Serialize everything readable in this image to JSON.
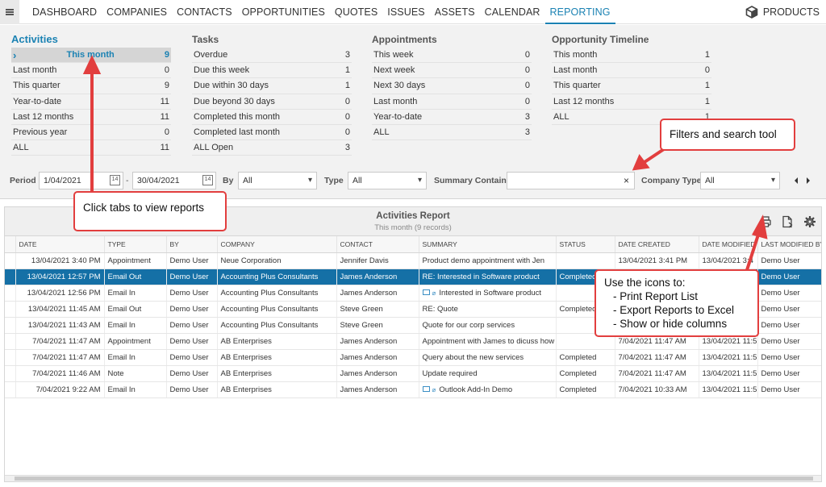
{
  "nav": {
    "items": [
      "DASHBOARD",
      "COMPANIES",
      "CONTACTS",
      "OPPORTUNITIES",
      "QUOTES",
      "ISSUES",
      "ASSETS",
      "CALENDAR",
      "REPORTING"
    ],
    "active": "REPORTING",
    "products": "PRODUCTS"
  },
  "panel": {
    "activities": {
      "title": "Activities",
      "rows": [
        [
          "This month",
          "9"
        ],
        [
          "Last month",
          "0"
        ],
        [
          "This quarter",
          "9"
        ],
        [
          "Year-to-date",
          "11"
        ],
        [
          "Last 12 months",
          "11"
        ],
        [
          "Previous year",
          "0"
        ],
        [
          "ALL",
          "11"
        ]
      ]
    },
    "tasks": {
      "title": "Tasks",
      "rows": [
        [
          "Overdue",
          "3"
        ],
        [
          "Due this week",
          "1"
        ],
        [
          "Due within 30 days",
          "1"
        ],
        [
          "Due beyond 30 days",
          "0"
        ],
        [
          "Completed this month",
          "0"
        ],
        [
          "Completed last month",
          "0"
        ],
        [
          "ALL Open",
          "3"
        ]
      ]
    },
    "appointments": {
      "title": "Appointments",
      "rows": [
        [
          "This week",
          "0"
        ],
        [
          "Next week",
          "0"
        ],
        [
          "Next 30 days",
          "0"
        ],
        [
          "Last month",
          "0"
        ],
        [
          "Year-to-date",
          "3"
        ],
        [
          "ALL",
          "3"
        ]
      ]
    },
    "timeline": {
      "title": "Opportunity Timeline",
      "rows": [
        [
          "This month",
          "1"
        ],
        [
          "Last month",
          "0"
        ],
        [
          "This quarter",
          "1"
        ],
        [
          "Last 12 months",
          "1"
        ],
        [
          "ALL",
          "1"
        ]
      ]
    }
  },
  "filters": {
    "period_label": "Period",
    "period_from": "1/04/2021",
    "dash": "-",
    "period_to": "30/04/2021",
    "by_label": "By",
    "by_value": "All",
    "type_label": "Type",
    "type_value": "All",
    "summary_label": "Summary Contains",
    "summary_value": "",
    "clear": "×",
    "company_type_label": "Company Type",
    "company_type_value": "All",
    "cal_glyph": "14"
  },
  "report": {
    "title": "Activities Report",
    "subtitle": "This month (9 records)",
    "columns": [
      "DATE",
      "TYPE",
      "BY",
      "COMPANY",
      "CONTACT",
      "SUMMARY",
      "STATUS",
      "DATE CREATED",
      "DATE MODIFIED",
      "LAST MODIFIED BY"
    ],
    "rows": [
      {
        "date": "13/04/2021 3:40 PM",
        "type": "Appointment",
        "by": "Demo User",
        "company": "Neue Corporation",
        "contact": "Jennifer Davis",
        "summary": "Product demo appointment with Jen",
        "icons": false,
        "status": "",
        "created": "13/04/2021 3:41 PM",
        "modified": "13/04/2021 3:4",
        "modby": "Demo User"
      },
      {
        "date": "13/04/2021 12:57 PM",
        "type": "Email Out",
        "by": "Demo User",
        "company": "Accounting Plus Consultants",
        "contact": "James Anderson",
        "summary": "RE: Interested in Software product",
        "icons": false,
        "status": "Completed",
        "created": "",
        "modified": "",
        "modby": "Demo User",
        "selected": true
      },
      {
        "date": "13/04/2021 12:56 PM",
        "type": "Email In",
        "by": "Demo User",
        "company": "Accounting Plus Consultants",
        "contact": "James Anderson",
        "summary": "Interested in Software product",
        "icons": true,
        "status": "",
        "created": "",
        "modified": "",
        "modby": "Demo User"
      },
      {
        "date": "13/04/2021 11:45 AM",
        "type": "Email Out",
        "by": "Demo User",
        "company": "Accounting Plus Consultants",
        "contact": "Steve Green",
        "summary": "RE: Quote",
        "icons": false,
        "status": "Completed",
        "created": "",
        "modified": "",
        "modby": "Demo User"
      },
      {
        "date": "13/04/2021 11:43 AM",
        "type": "Email In",
        "by": "Demo User",
        "company": "Accounting Plus Consultants",
        "contact": "Steve Green",
        "summary": "Quote for our corp services",
        "icons": false,
        "status": "",
        "created": "",
        "modified": "",
        "modby": "Demo User"
      },
      {
        "date": "7/04/2021 11:47 AM",
        "type": "Appointment",
        "by": "Demo User",
        "company": "AB Enterprises",
        "contact": "James Anderson",
        "summary": "Appointment with James to dicuss how c",
        "icons": false,
        "status": "",
        "created": "7/04/2021 11:47 AM",
        "modified": "13/04/2021 11:5",
        "modby": "Demo User"
      },
      {
        "date": "7/04/2021 11:47 AM",
        "type": "Email In",
        "by": "Demo User",
        "company": "AB Enterprises",
        "contact": "James Anderson",
        "summary": "Query about the new services",
        "icons": false,
        "status": "Completed",
        "created": "7/04/2021 11:47 AM",
        "modified": "13/04/2021 11:5",
        "modby": "Demo User"
      },
      {
        "date": "7/04/2021 11:46 AM",
        "type": "Note",
        "by": "Demo User",
        "company": "AB Enterprises",
        "contact": "James Anderson",
        "summary": "Update required",
        "icons": false,
        "status": "Completed",
        "created": "7/04/2021 11:47 AM",
        "modified": "13/04/2021 11:5",
        "modby": "Demo User"
      },
      {
        "date": "7/04/2021 9:22 AM",
        "type": "Email In",
        "by": "Demo User",
        "company": "AB Enterprises",
        "contact": "James Anderson",
        "summary": "Outlook Add-In Demo",
        "icons": true,
        "status": "Completed",
        "created": "7/04/2021 10:33 AM",
        "modified": "13/04/2021 11:5",
        "modby": "Demo User"
      }
    ]
  },
  "callouts": {
    "filters": "Filters and search tool",
    "tabs": "Click tabs to view reports",
    "icons_title": "Use the icons to:",
    "icons_lines": [
      "- Print Report List",
      "- Export Reports to Excel",
      "- Show or hide columns"
    ]
  },
  "colors": {
    "accent": "#1b82b3",
    "selected_row": "#1570a6",
    "callout_border": "#e23e3e"
  }
}
